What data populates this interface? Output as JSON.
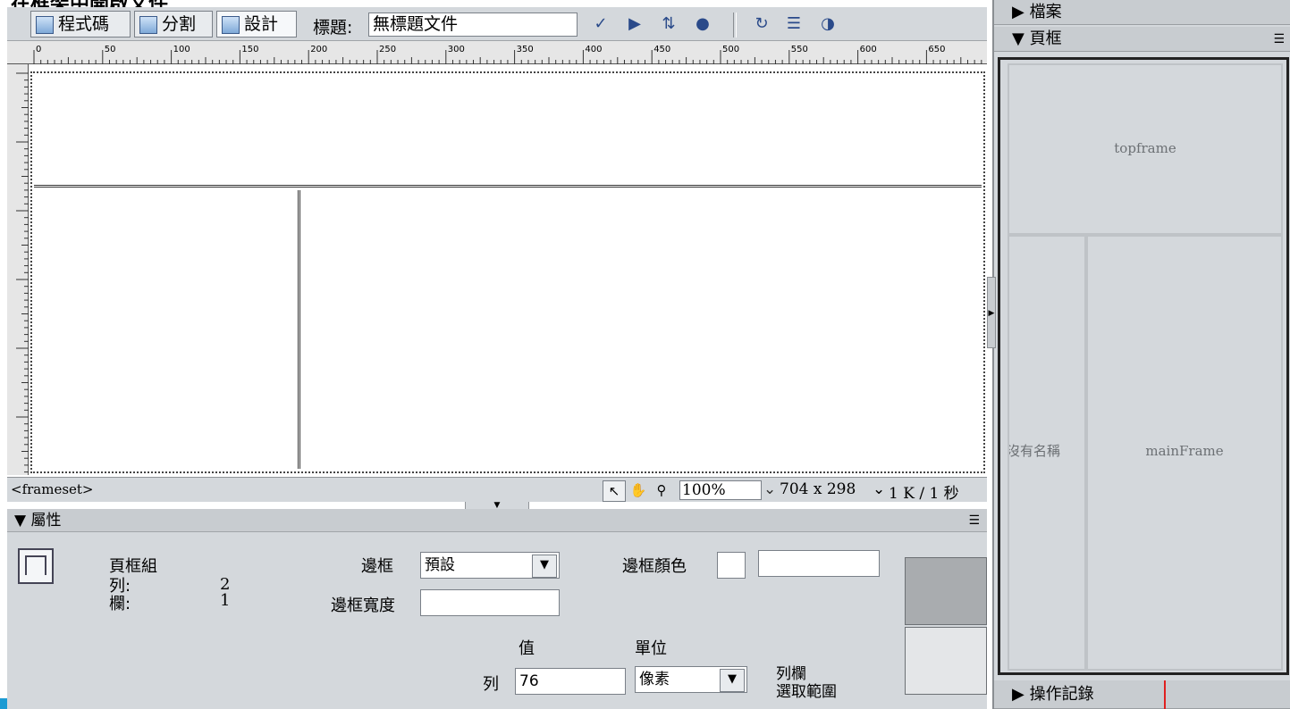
{
  "window": {
    "title_partial": "在框架中開啟文件"
  },
  "toolbar": {
    "code_label": "程式碼",
    "split_label": "分割",
    "design_label": "設計",
    "title_label": "標題:",
    "title_value": "無標題文件"
  },
  "ruler": {
    "ticks": [
      "0",
      "50",
      "100",
      "150",
      "200",
      "250",
      "300",
      "350",
      "400",
      "450",
      "500",
      "550",
      "600",
      "650"
    ]
  },
  "status": {
    "tag": "<frameset>",
    "zoom": "100%",
    "size": "704 x 298",
    "download": "1 K / 1 秒"
  },
  "properties": {
    "header": "屬性",
    "type_label": "頁框組",
    "rows_label": "列:",
    "rows_value": "2",
    "cols_label": "欄:",
    "cols_value": "1",
    "border_label": "邊框",
    "border_value": "預設",
    "border_width_label": "邊框寬度",
    "border_color_label": "邊框顏色",
    "value_heading": "值",
    "unit_heading": "單位",
    "row_label": "列",
    "row_value": "76",
    "unit_value": "像素",
    "rowcol_select_line1": "列欄",
    "rowcol_select_line2": "選取範圍"
  },
  "right_panel": {
    "files_header": "檔案",
    "frames_header": "頁框",
    "topframe": "topframe",
    "left_frame": "沒有名稱",
    "mainframe": "mainFrame",
    "history_header": "操作記錄"
  }
}
